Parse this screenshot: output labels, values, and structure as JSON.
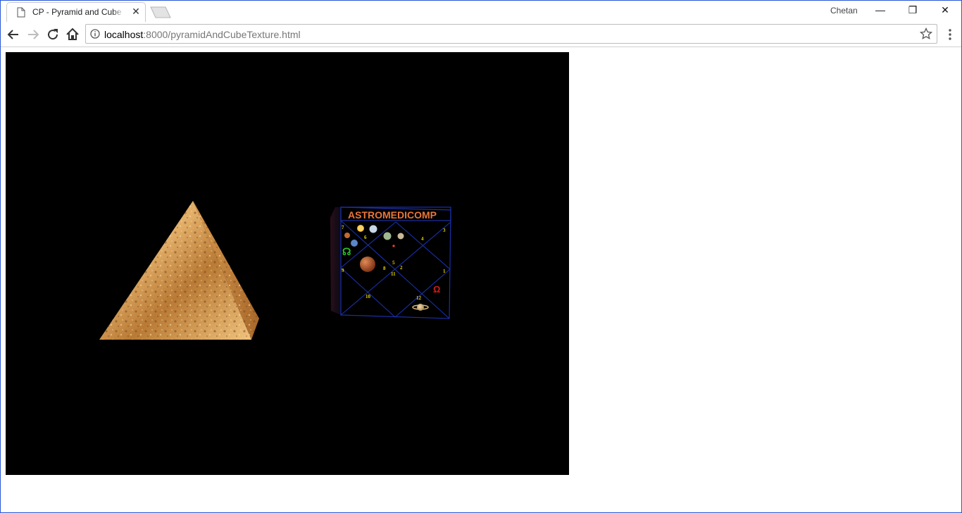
{
  "tab": {
    "title": "CP - Pyramid and Cube T",
    "close_glyph": "✕"
  },
  "window": {
    "profile_name": "Chetan",
    "minimize_glyph": "—",
    "restore_glyph": "❐",
    "close_glyph": "✕"
  },
  "address": {
    "host": "localhost",
    "path": ":8000/pyramidAndCubeTexture.html"
  },
  "cube": {
    "banner": "ASTROMEDICOMP",
    "house_numbers": [
      "7",
      "6",
      "3",
      "4",
      "5",
      "8",
      "2",
      "11",
      "9",
      "1",
      "10",
      "12"
    ],
    "rahu_symbol": "☊",
    "ketu_symbol": "Ω"
  },
  "colors": {
    "canvas_bg": "#000000",
    "window_border": "#2b57d6",
    "banner_text": "#e8763a",
    "chart_lines": "#1a2fa8",
    "numbers": "#e6d200"
  }
}
